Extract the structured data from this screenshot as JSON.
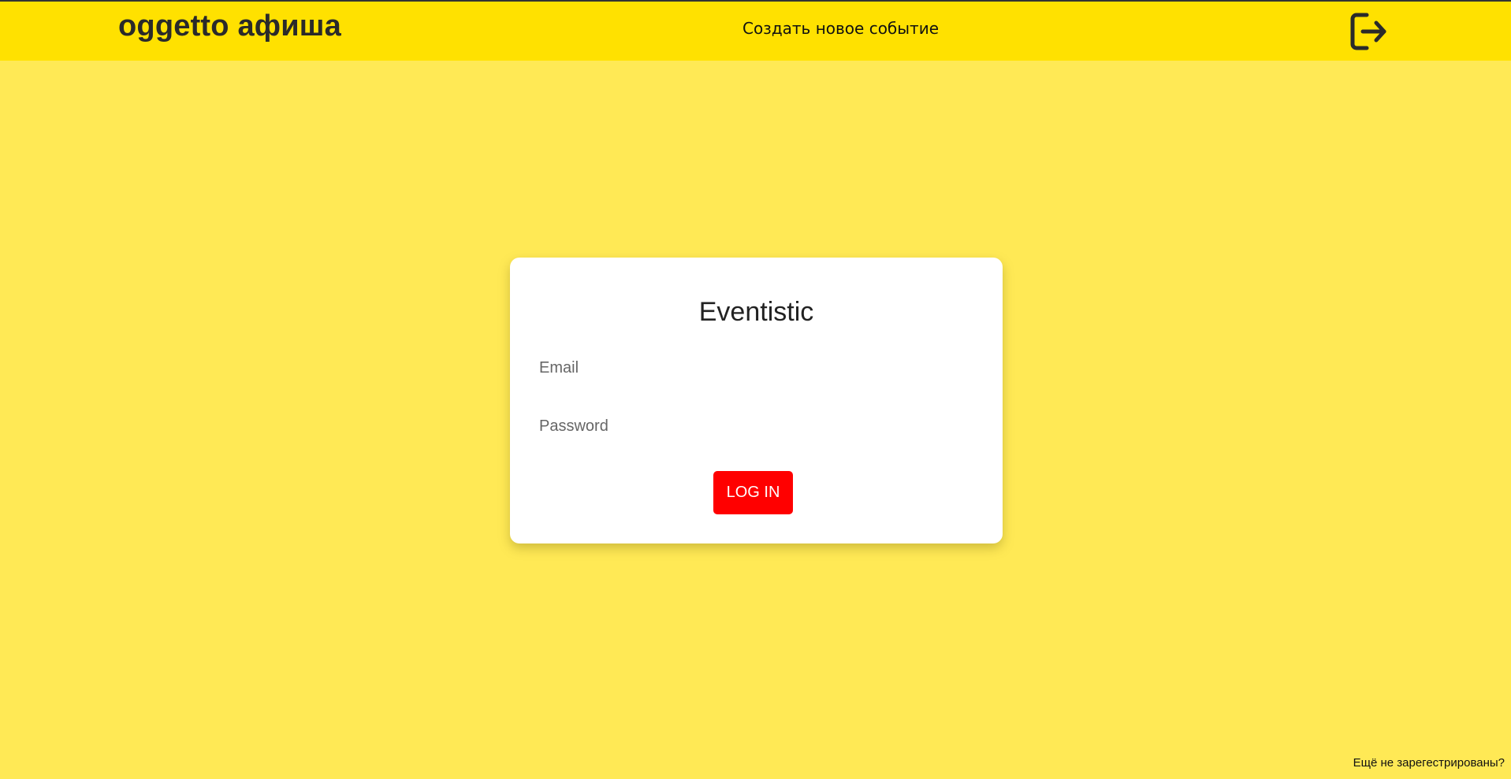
{
  "header": {
    "logo": "oggetto афиша",
    "create_event": "Создать новое событие",
    "logout_icon": "logout-icon"
  },
  "login_card": {
    "title": "Eventistic",
    "email_placeholder": "Email",
    "email_value": "",
    "password_placeholder": "Password",
    "password_value": "",
    "login_button": "LOG IN"
  },
  "footer": {
    "register_link": "Ещё не зарегестрированы?"
  },
  "colors": {
    "page_background": "#ffe955",
    "header_background": "#ffe100",
    "button_background": "#ff0000",
    "card_background": "#ffffff"
  }
}
